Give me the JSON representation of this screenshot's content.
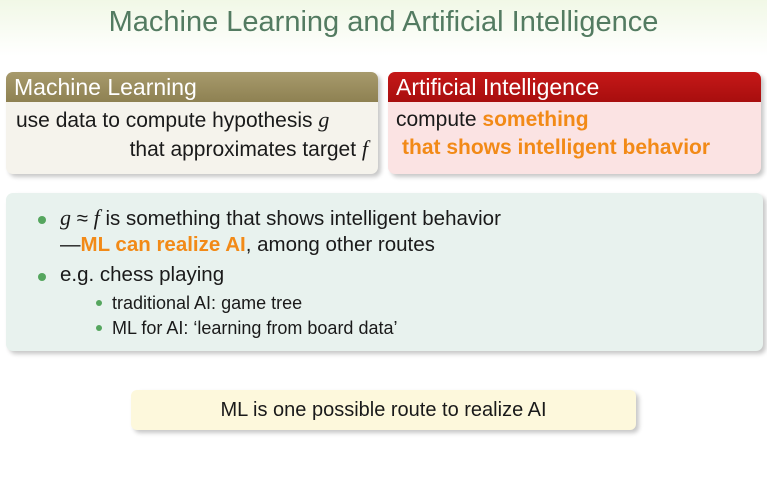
{
  "slide": {
    "title": "Machine Learning and Artificial Intelligence"
  },
  "ml_block": {
    "heading": "Machine Learning",
    "line1_text": "use data to compute hypothesis ",
    "line1_var": "g",
    "line2_text": "that approximates target ",
    "line2_var": "f"
  },
  "ai_block": {
    "heading": "Artificial Intelligence",
    "line1_text": "compute ",
    "line1_highlight": "something",
    "line2_highlight": "that shows intelligent behavior"
  },
  "points": {
    "p1_var_g": "g",
    "p1_approx": "≈",
    "p1_var_f": "f",
    "p1_text": " is something that shows intelligent behavior",
    "p1_line2_dash": "—",
    "p1_line2_highlight": "ML can realize AI",
    "p1_line2_rest": ", among other routes",
    "p2_text": "e.g. chess playing",
    "sub1_text": "traditional AI: game tree",
    "sub2_text": "ML for AI: ‘learning from board data’"
  },
  "note": {
    "text": "ML is one possible route to realize AI"
  },
  "colors": {
    "title": "#537b61",
    "ml_header": "#9a8d5e",
    "ai_header": "#b81414",
    "highlight": "#f28a17",
    "bullet": "#55a65e"
  }
}
